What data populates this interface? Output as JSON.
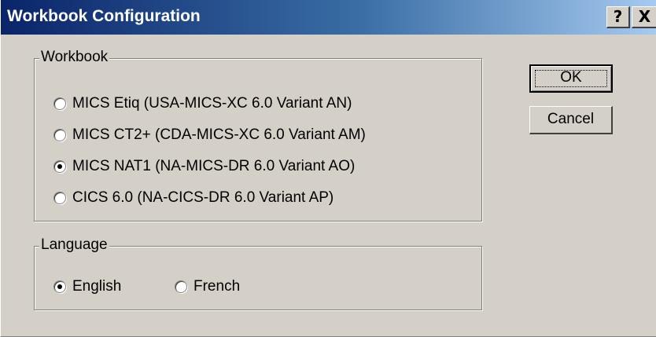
{
  "window": {
    "title": "Workbook Configuration",
    "help_label": "?",
    "close_label": "X"
  },
  "workbook_group": {
    "label": "Workbook",
    "options": [
      {
        "label": "MICS Etiq (USA-MICS-XC 6.0 Variant AN)",
        "checked": false
      },
      {
        "label": "MICS CT2+ (CDA-MICS-XC 6.0 Variant AM)",
        "checked": false
      },
      {
        "label": "MICS NAT1 (NA-MICS-DR 6.0  Variant AO)",
        "checked": true
      },
      {
        "label": "CICS 6.0 (NA-CICS-DR 6.0 Variant AP)",
        "checked": false
      }
    ]
  },
  "language_group": {
    "label": "Language",
    "options": [
      {
        "label": "English",
        "checked": true
      },
      {
        "label": "French",
        "checked": false
      }
    ]
  },
  "buttons": {
    "ok_label": "OK",
    "cancel_label": "Cancel"
  }
}
